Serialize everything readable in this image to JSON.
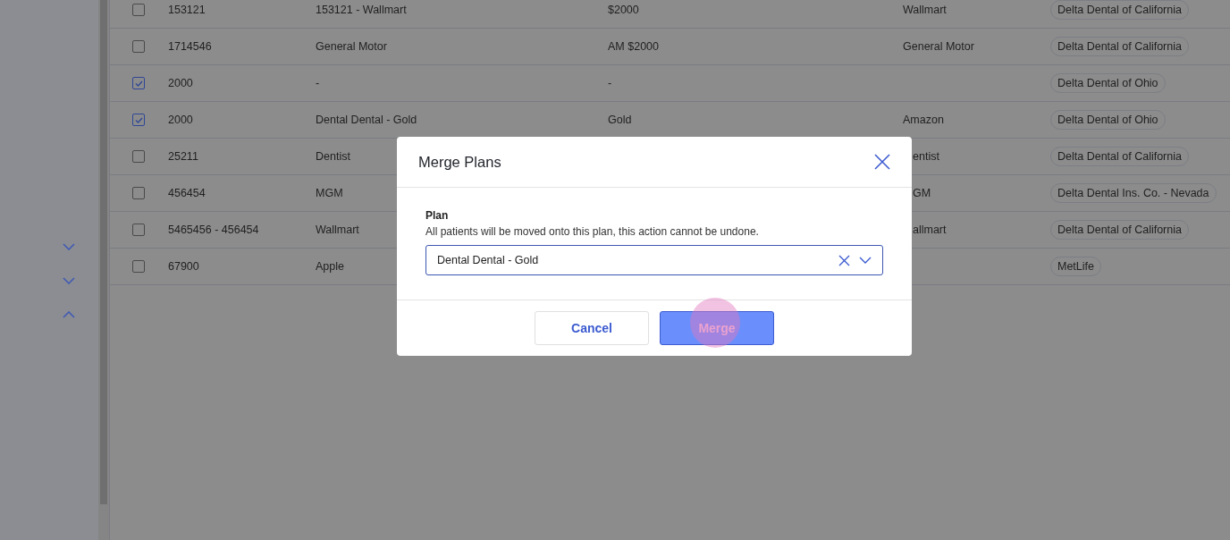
{
  "sidebar": {
    "toggles": [
      {
        "expanded": false
      },
      {
        "expanded": false
      },
      {
        "expanded": true
      }
    ]
  },
  "table": {
    "rows": [
      {
        "checked": false,
        "cells": [
          "153121",
          "153121 - Wallmart",
          "$2000",
          "Wallmart"
        ],
        "carrier": "Delta Dental of California"
      },
      {
        "checked": false,
        "cells": [
          "1714546",
          "General Motor",
          "AM $2000",
          "General Motor"
        ],
        "carrier": "Delta Dental of California"
      },
      {
        "checked": true,
        "cells": [
          "2000",
          "-",
          "-",
          null
        ],
        "carrier": "Delta Dental of Ohio"
      },
      {
        "checked": true,
        "cells": [
          "2000",
          "Dental Dental - Gold",
          "Gold",
          "Amazon"
        ],
        "carrier": "Delta Dental of Ohio"
      },
      {
        "checked": false,
        "cells": [
          "25211",
          "Dentist",
          null,
          "entist"
        ],
        "covered": true,
        "carrier": "Delta Dental of California"
      },
      {
        "checked": false,
        "cells": [
          "456454",
          "MGM",
          null,
          "GM"
        ],
        "covered": true,
        "carrier": "Delta Dental Ins. Co. - Nevada"
      },
      {
        "checked": false,
        "cells": [
          "5465456 - 456454",
          "Wallmart",
          null,
          "allmart"
        ],
        "covered": true,
        "carrier": "Delta Dental of California"
      },
      {
        "checked": false,
        "cells": [
          "67900",
          "Apple",
          null,
          null
        ],
        "carrier": "MetLife"
      }
    ]
  },
  "dialog": {
    "title": "Merge Plans",
    "field_label": "Plan",
    "field_hint": "All patients will be moved onto this plan, this action cannot be undone.",
    "value": "Dental Dental - Gold",
    "buttons": [
      {
        "label": "Cancel",
        "kind": "secondary"
      },
      {
        "label": "Merge",
        "kind": "primary"
      }
    ]
  }
}
